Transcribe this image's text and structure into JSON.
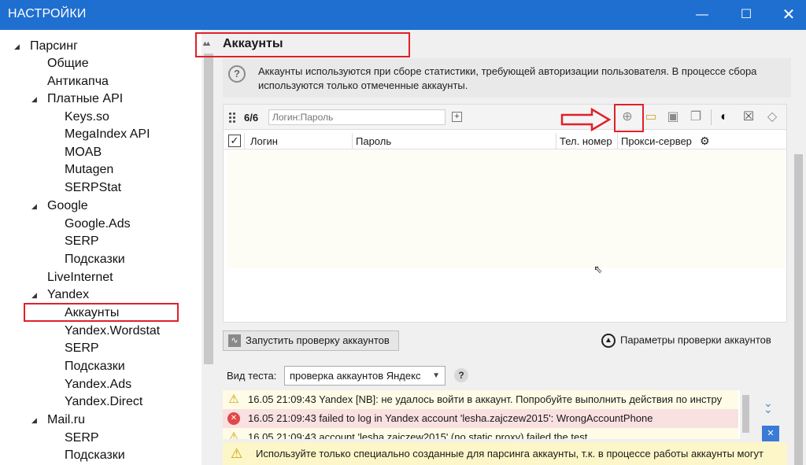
{
  "window": {
    "title": "НАСТРОЙКИ",
    "minimize": "—",
    "maximize": "☐",
    "close": "✕"
  },
  "tree": [
    {
      "label": "Парсинг",
      "level": 0,
      "expandable": true
    },
    {
      "label": "Общие",
      "level": 1
    },
    {
      "label": "Антикапча",
      "level": 1
    },
    {
      "label": "Платные API",
      "level": 1,
      "expandable": true
    },
    {
      "label": "Keys.so",
      "level": 2
    },
    {
      "label": "MegaIndex API",
      "level": 2
    },
    {
      "label": "MOAB",
      "level": 2
    },
    {
      "label": "Mutagen",
      "level": 2
    },
    {
      "label": "SERPStat",
      "level": 2
    },
    {
      "label": "Google",
      "level": 1,
      "expandable": true
    },
    {
      "label": "Google.Ads",
      "level": 2
    },
    {
      "label": "SERP",
      "level": 2
    },
    {
      "label": "Подсказки",
      "level": 2
    },
    {
      "label": "LiveInternet",
      "level": 1
    },
    {
      "label": "Yandex",
      "level": 1,
      "expandable": true
    },
    {
      "label": "Аккаунты",
      "level": 2,
      "selected": true
    },
    {
      "label": "Yandex.Wordstat",
      "level": 2
    },
    {
      "label": "SERP",
      "level": 2
    },
    {
      "label": "Подсказки",
      "level": 2
    },
    {
      "label": "Yandex.Ads",
      "level": 2
    },
    {
      "label": "Yandex.Direct",
      "level": 2
    },
    {
      "label": "Mail.ru",
      "level": 1,
      "expandable": true
    },
    {
      "label": "SERP",
      "level": 2
    },
    {
      "label": "Подсказки",
      "level": 2
    }
  ],
  "section": {
    "title": "Аккаунты",
    "info": "Аккаунты используются при сборе статистики, требующей авторизации пользователя. В процессе сбора используются только отмеченные аккаунты."
  },
  "accounts": {
    "count": "6/6",
    "input_placeholder": "Логин:Пароль",
    "columns": {
      "login": "Логин",
      "password": "Пароль",
      "phone": "Тел. номер",
      "proxy": "Прокси-сервер"
    }
  },
  "actions": {
    "start_check": "Запустить проверку аккаунтов",
    "check_params": "Параметры проверки аккаунтов",
    "test_type_label": "Вид теста:",
    "test_type_value": "проверка аккаунтов Яндекс"
  },
  "log": [
    {
      "level": "warning",
      "text": "16.05 21:09:43  Yandex [NB]: не удалось войти в аккаунт. Попробуйте выполнить действия по инстру"
    },
    {
      "level": "error",
      "text": "16.05 21:09:43  failed to log in Yandex account 'lesha.zajczew2015': WrongAccountPhone"
    },
    {
      "level": "warning",
      "text": "16.05 21:09:43  account 'lesha.zajczew2015' (no static proxy) failed the test"
    }
  ],
  "banner": "Используйте только специально созданные для парсинга аккаунты, т.к. в процессе работы аккаунты могут",
  "colors": {
    "titlebar": "#1f6fd0",
    "highlight": "#e0202a",
    "warning_bg": "#fffbe6",
    "error_bg": "#f9e1e1"
  }
}
